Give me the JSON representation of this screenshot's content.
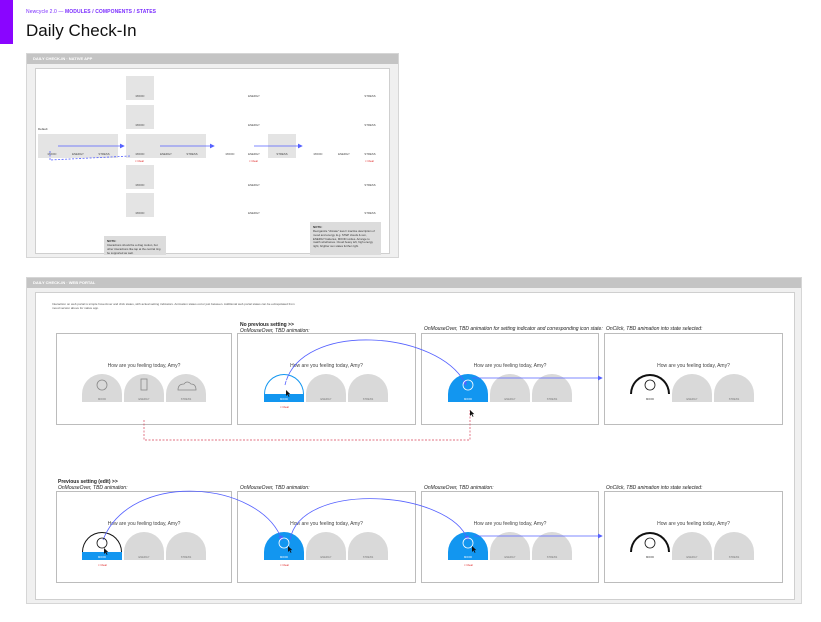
{
  "header": {
    "breadcrumb_prefix": "Newcycle 2.0 —",
    "breadcrumb_path": "MODULES / COMPONENTS / STATES",
    "title": "Daily Check-In"
  },
  "native_panel": {
    "title": "DAILY CHECK-IN · NATIVE APP",
    "default_label": "Default",
    "note_left": {
      "heading": "NOTE:",
      "body": "Interactions should be a drag motion, but other interactions like tap at the central ring be supported as well."
    },
    "note_right": {
      "heading": "NOTE:",
      "body": "Reorganize \"climate\" level / inactive description of mood and energy. E.g. STEP clouds & sun, ENERGY batteries, MOOD smiles. Arrange to match wireframes. Cloud heavy left, high energy right, brighter sun states further right."
    },
    "mood_column": [
      "MOOD",
      "MOOD",
      "MOOD",
      "MOOD",
      "MOOD"
    ],
    "energy_column": [
      "ENERGY",
      "ENERGY",
      "ENERGY",
      "ENERGY",
      "ENERGY"
    ],
    "stress_column": [
      "STRESS",
      "STRESS",
      "STRESS",
      "STRESS",
      "STRESS"
    ],
    "row_labels": [
      "MOOD",
      "ENERGY",
      "STRESS"
    ],
    "clear_label": "× Clear"
  },
  "web_panel": {
    "title": "DAILY CHECK-IN · WEB PORTAL",
    "intro": "Interaction on web portal is simple hover/over and click states, with actual setting indicators. Animation states occur just between. Additional web portal states can be extrapolated from mood version above for native app.",
    "question": "How are you feeling today, Amy?",
    "gauge_labels": {
      "mood": "MOOD",
      "energy": "ENERGY",
      "stress": "STRESS"
    },
    "clear_label": "× Clear",
    "row1": {
      "label_2_bold": "No previous setting >>",
      "label_2": "OnMouseOver, TBD animation:",
      "label_3": "OnMouseOver, TBD animation for setting indicator and corresponding icon state:",
      "label_4": "OnClick, TBD animation into state selected:"
    },
    "row2": {
      "label_1_bold": "Previous setting (edit) >>",
      "label_1": "OnMouseOver, TBD animation:",
      "label_2": "OnMouseOver, TBD animation:",
      "label_3": "OnMouseOver, TBD animation:",
      "label_4": "OnClick, TBD animation into state selected:"
    }
  },
  "colors": {
    "accent": "#8a05ff",
    "flow": "#5561ff",
    "dashed_flow": "#d8435a",
    "selected": "#1296f0"
  }
}
